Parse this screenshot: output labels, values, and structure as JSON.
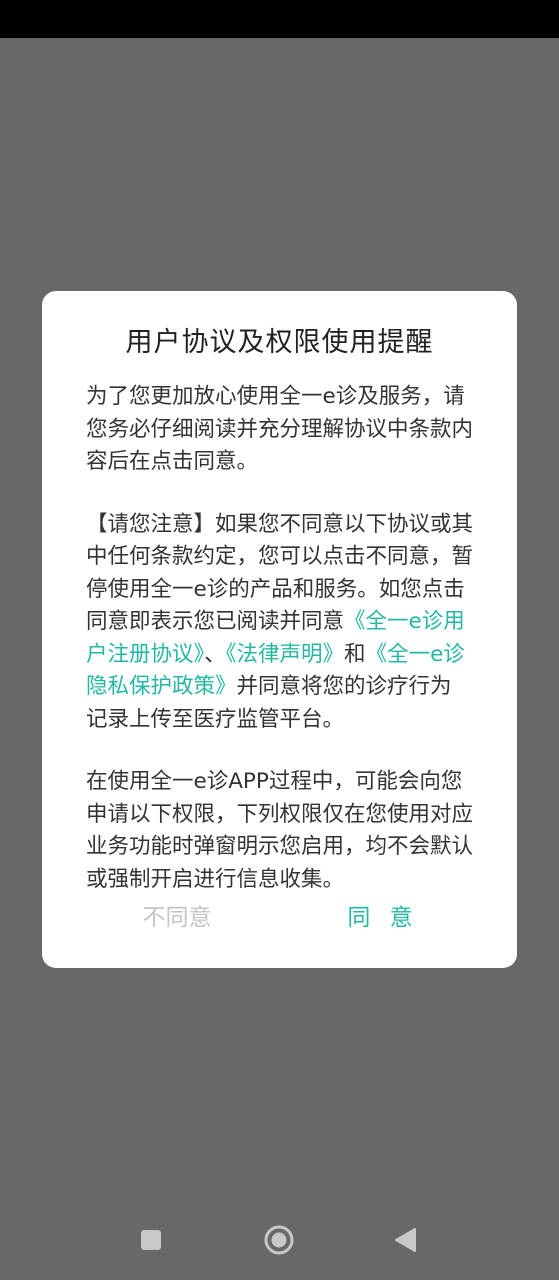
{
  "dialog": {
    "title": "用户协议及权限使用提醒",
    "para1": "为了您更加放心使用全一e诊及服务，请您务必仔细阅读并充分理解协议中条款内容后在点击同意。",
    "para2": {
      "text1": "【请您注意】如果您不同意以下协议或其中任何条款约定，您可以点击不同意，暂停使用全一e诊的产品和服务。如您点击同意即表示您已阅读并同意",
      "link1": "《全一e诊用户注册协议》",
      "sep1": "、",
      "link2": "《法律声明》",
      "sep2": "和",
      "link3": "《全一e诊 隐私保护政策》",
      "text2": "并同意将您的诊疗行为记录上传至医疗监管平台。"
    },
    "para3": "在使用全一e诊APP过程中，可能会向您申请以下权限，下列权限仅在您使用对应业务功能时弹窗明示您启用，均不会默认或强制开启进行信息收集。",
    "disagree_label": "不同意",
    "agree_label": "同 意"
  },
  "nav": {
    "recent_icon": "square-icon",
    "home_icon": "circle-icon",
    "back_icon": "triangle-back-icon"
  },
  "colors": {
    "accent": "#22b8a4",
    "overlay": "#686868",
    "disabled": "#c4c4c4"
  }
}
